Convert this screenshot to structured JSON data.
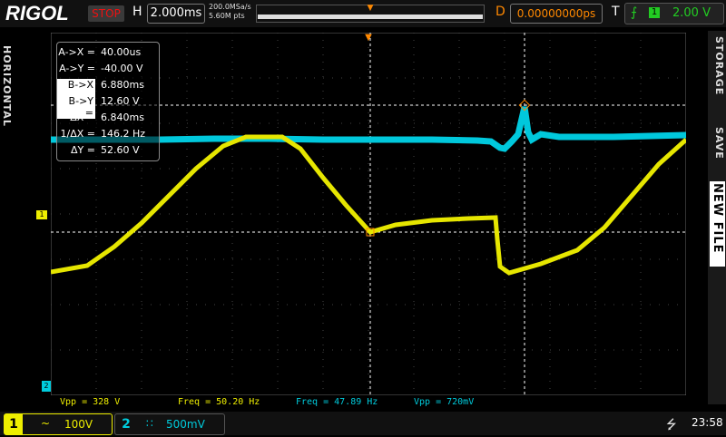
{
  "brand": "RIGOL",
  "run_state": "STOP",
  "horizontal": {
    "label": "H",
    "timebase": "2.000ms",
    "sample_rate": "200.0MSa/s",
    "memory_depth": "5.60M pts"
  },
  "delay": {
    "label": "D",
    "value": "0.00000000ps"
  },
  "trigger": {
    "label": "T",
    "source": "1",
    "level": "2.00 V",
    "color": "#22cc22"
  },
  "side_tabs": {
    "left": "HORIZONTAL",
    "right_storage": "STORAGE",
    "right_save": "SAVE",
    "right_newfile": "NEW FILE"
  },
  "measurements": [
    {
      "key": "A->X =",
      "value": "40.00us",
      "highlight": false
    },
    {
      "key": "A->Y =",
      "value": "-40.00 V",
      "highlight": false
    },
    {
      "key": "B->X =",
      "value": "6.880ms",
      "highlight": true
    },
    {
      "key": "B->Y =",
      "value": "12.60 V",
      "highlight": true
    },
    {
      "key": "ΔX =",
      "value": "6.840ms",
      "highlight": false
    },
    {
      "key": "1/ΔX =",
      "value": "146.2 Hz",
      "highlight": false
    },
    {
      "key": "ΔY =",
      "value": "52.60 V",
      "highlight": false
    }
  ],
  "bottom_measures": {
    "ch1_vpp": "Vpp = 328 V",
    "ch1_freq": "Freq = 50.20 Hz",
    "ch2_freq": "Freq = 47.89 Hz",
    "ch2_vpp": "Vpp = 720mV"
  },
  "channels": {
    "ch1": {
      "number": "1",
      "coupling": "~",
      "scale": "100V",
      "color": "#eeee00"
    },
    "ch2": {
      "number": "2",
      "coupling": "∷",
      "scale": "500mV",
      "color": "#00ccdd"
    }
  },
  "status": {
    "usb_icon": "usb-icon",
    "time": "23:58"
  },
  "marker_labels": {
    "ch1": "1",
    "ch2": "2"
  },
  "colors": {
    "trigger_marker": "#ff8800",
    "grid": "#444444"
  }
}
